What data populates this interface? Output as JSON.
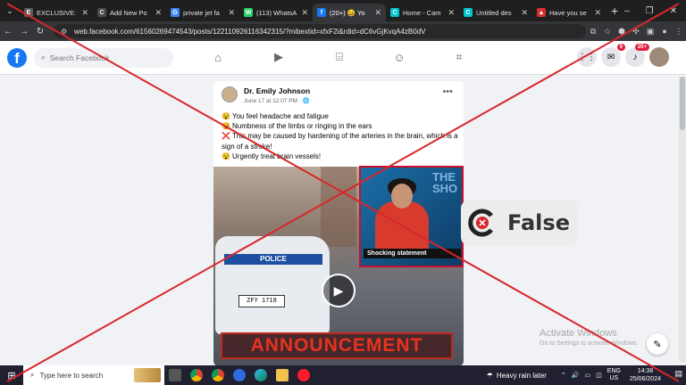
{
  "browser": {
    "tabs": [
      {
        "title": "EXCLUSIVE: I",
        "color": "#5c5c5c",
        "glyph": "E"
      },
      {
        "title": "Add New Po",
        "color": "#4a4a4a",
        "glyph": "C"
      },
      {
        "title": "private jet fa",
        "color": "#4285f4",
        "glyph": "G"
      },
      {
        "title": "(113) WhatsA",
        "color": "#25d366",
        "glyph": "W"
      },
      {
        "title": "(20+) 😀 Yo",
        "color": "#1877f2",
        "glyph": "f"
      },
      {
        "title": "Home - Cam",
        "color": "#00c4cc",
        "glyph": "C"
      },
      {
        "title": "Untitled des",
        "color": "#00c4cc",
        "glyph": "C"
      },
      {
        "title": "Have you se",
        "color": "#d32f2f",
        "glyph": "▲"
      }
    ],
    "url": "web.facebook.com/61560269474543/posts/122110926116342315/?mibextid=xfxF2i&rdid=dC6vGjKvqA4zB0dV"
  },
  "fb": {
    "logo": "f",
    "search_placeholder": "Search Facebook",
    "messenger_badge": "9",
    "notif_badge": "20+"
  },
  "post": {
    "author": "Dr. Emily Johnson",
    "date": "June 17 at 12:07 PM · ",
    "lines": [
      {
        "emoji": "😵",
        "text": "You feel headache and fatigue"
      },
      {
        "emoji": "😵",
        "text": "Numbness of the limbs or ringing in the ears"
      },
      {
        "emoji": "❌",
        "text": "This may be caused by hardening of the arteries in the brain, which is a sign of a stroke!"
      },
      {
        "emoji": "😵",
        "text": "Urgently treat brain vessels!"
      }
    ],
    "car_label": "POLICE",
    "plate": "ZFY 1718",
    "announcement": "ANNOUNCEMENT"
  },
  "inset": {
    "bg_text": "THE SHO",
    "caption": "Shocking statement"
  },
  "verdict": {
    "label": "False",
    "color": "#d8262b"
  },
  "watermark": {
    "title": "Activate Windows",
    "subtitle": "Go to Settings to activate Windows."
  },
  "taskbar": {
    "search_placeholder": "Type here to search",
    "weather": "Heavy rain later",
    "lang1": "ENG",
    "lang2": "US",
    "time": "14:38",
    "date": "25/06/2024"
  }
}
